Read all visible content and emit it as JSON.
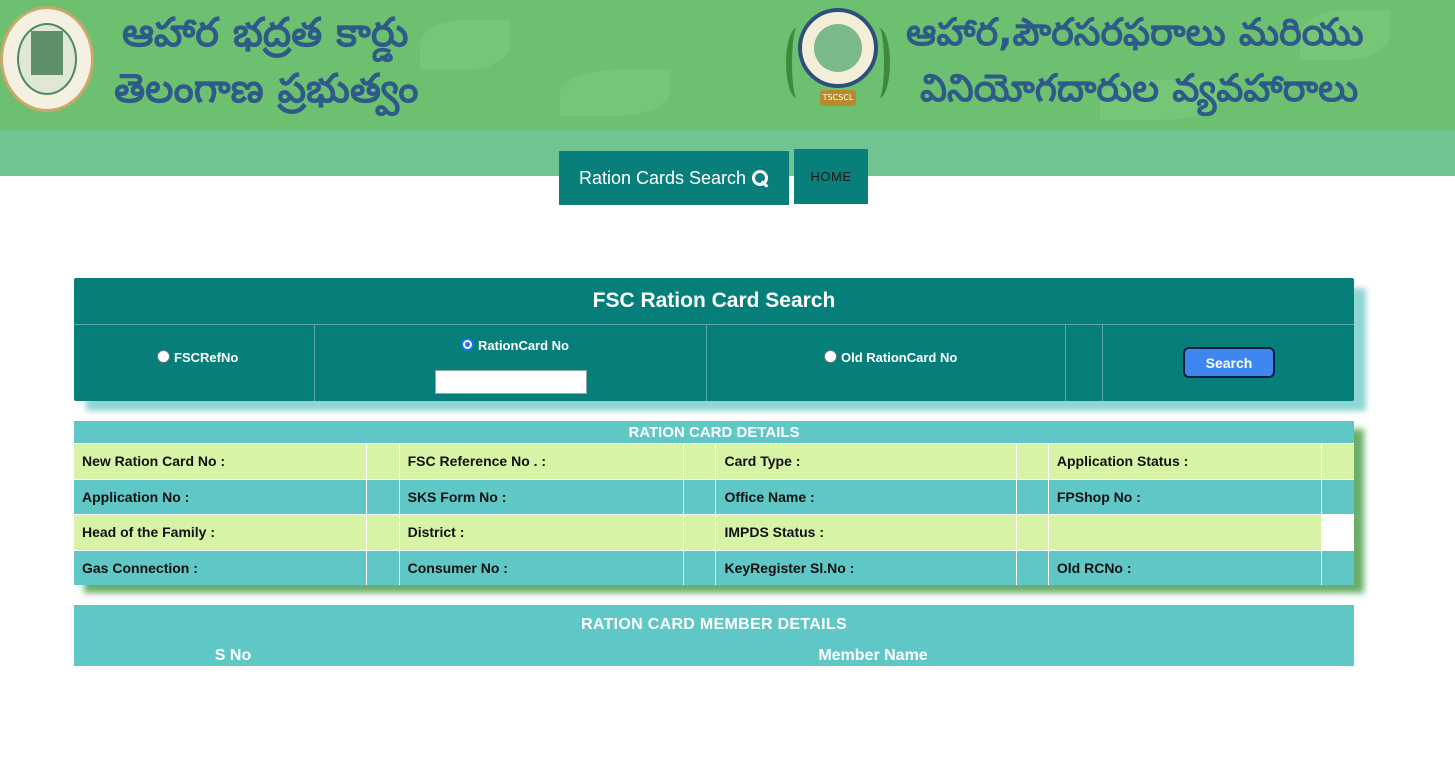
{
  "banner": {
    "left_line1": "ఆహార భద్రత కార్డు",
    "left_line2": "తెలంగాణ ప్రభుత్వం",
    "right_line1": "ఆహార,పౌరసరఫరాలు మరియు",
    "right_line2": "వినియోగదారుల వ్యవహారాలు",
    "right_seal_ribbon": "TSCSCL",
    "text_color": "#2e5a8a",
    "background_color": "#6cc070"
  },
  "nav": {
    "search_label": "Ration Cards Search",
    "home_label": "HOME",
    "accent_color": "#087f7a"
  },
  "search_panel": {
    "title": "FSC Ration Card Search",
    "options": [
      {
        "label": "FSCRefNo",
        "checked": false
      },
      {
        "label": "RationCard No",
        "checked": true
      },
      {
        "label": "Old RationCard No",
        "checked": false
      }
    ],
    "input_value": "",
    "search_button": "Search"
  },
  "details": {
    "title": "RATION CARD DETAILS",
    "rows": [
      [
        "New Ration Card No :",
        "FSC Reference No . :",
        "Card Type :",
        "Application Status :"
      ],
      [
        "Application No :",
        "SKS Form No :",
        "Office Name :",
        "FPShop No :"
      ],
      [
        "Head of the Family :",
        "District :",
        "IMPDS Status :",
        ""
      ],
      [
        "Gas Connection :",
        "Consumer No :",
        "KeyRegister Sl.No :",
        "Old RCNo :"
      ]
    ]
  },
  "members": {
    "title": "RATION CARD MEMBER DETAILS",
    "columns": [
      "S No",
      "Member Name"
    ]
  }
}
